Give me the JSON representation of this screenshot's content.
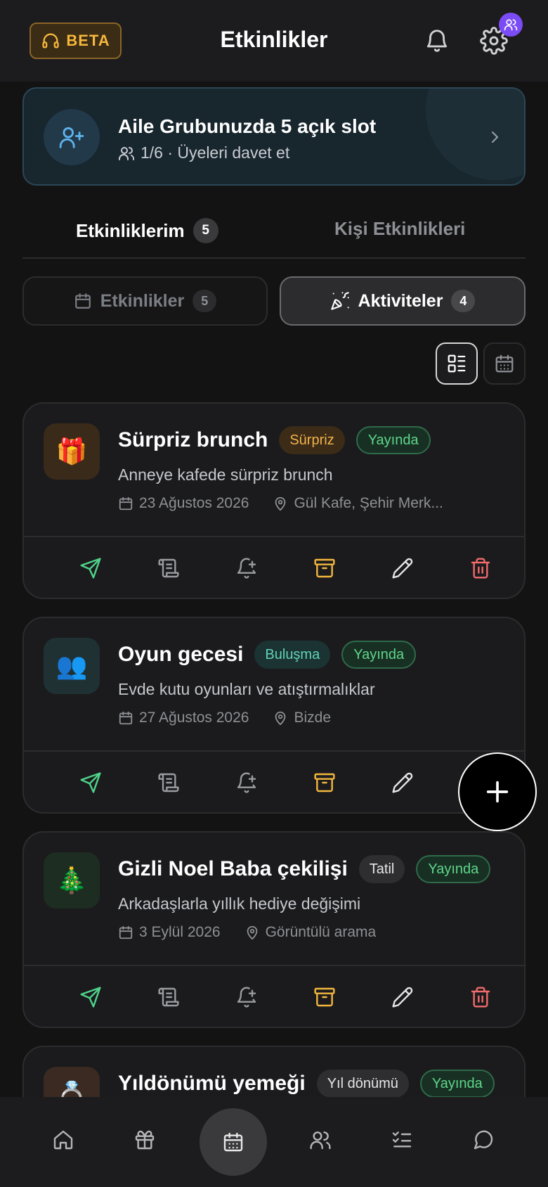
{
  "header": {
    "beta_label": "BETA",
    "title": "Etkinlikler",
    "icons": {
      "support": "headset-icon",
      "notifications": "bell-icon",
      "settings": "gear-icon",
      "settings_badge": "users-icon"
    }
  },
  "family_banner": {
    "title": "Aile Grubunuzda 5 açık slot",
    "subtitle": "1/6 · Üyeleri davet et",
    "icon": "user-plus-icon"
  },
  "tabs": [
    {
      "label": "Etkinliklerim",
      "count": "5",
      "active": true
    },
    {
      "label": "Kişi Etkinlikleri",
      "active": false
    }
  ],
  "segments": [
    {
      "label": "Etkinlikler",
      "count": "5",
      "icon": "calendar-icon",
      "active": false
    },
    {
      "label": "Aktiviteler",
      "count": "4",
      "icon": "party-popper-icon",
      "active": true
    }
  ],
  "view_modes": [
    "list-view-icon",
    "calendar-view-icon"
  ],
  "events": [
    {
      "emoji": "🎁",
      "title": "Sürpriz brunch",
      "category": "Sürpriz",
      "status": "Yayında",
      "description": "Anneye kafede sürpriz brunch",
      "date": "23 Ağustos 2026",
      "location": "Gül Kafe, Şehir Merk...",
      "colors": {
        "emoji_bg": "#3a2a19",
        "chip_bg": "#3b2b17",
        "chip_text": "#f3b24c"
      }
    },
    {
      "emoji": "👥",
      "title": "Oyun gecesi",
      "category": "Buluşma",
      "status": "Yayında",
      "description": "Evde kutu oyunları ve atıştırmalıklar",
      "date": "27 Ağustos 2026",
      "location": "Bizde",
      "colors": {
        "emoji_bg": "#1f3133",
        "chip_bg": "#1c3333",
        "chip_text": "#5fd3b8"
      }
    },
    {
      "emoji": "🎄",
      "title": "Gizli Noel Baba çekilişi",
      "category": "Tatil",
      "status": "Yayında",
      "description": "Arkadaşlarla yıllık hediye değişimi",
      "date": "3 Eylül 2026",
      "location": "Görüntülü arama",
      "colors": {
        "emoji_bg": "#1d2d22",
        "chip_bg": "#2e2e30",
        "chip_text": "#e6e6e6"
      }
    },
    {
      "emoji": "💍",
      "title": "Yıldönümü yemeği",
      "category": "Yıl dönümü",
      "status": "Yayında",
      "colors": {
        "emoji_bg": "#3a2a22",
        "chip_bg": "#2e2e30",
        "chip_text": "#e6e6e6"
      }
    }
  ],
  "card_actions": [
    "send-icon",
    "scroll-icon",
    "bell-plus-icon",
    "archive-icon",
    "pencil-icon",
    "trash-icon"
  ],
  "action_colors": {
    "send": "#4fd38a",
    "neutral": "#9a9ca1",
    "archive": "#f3b73e",
    "edit": "#e5e5e5",
    "delete": "#f26b6b"
  },
  "fab_icon": "plus-icon",
  "bottom_nav": [
    "home-icon",
    "gift-icon",
    "calendar-icon",
    "users-icon",
    "checklist-icon",
    "chat-icon"
  ]
}
